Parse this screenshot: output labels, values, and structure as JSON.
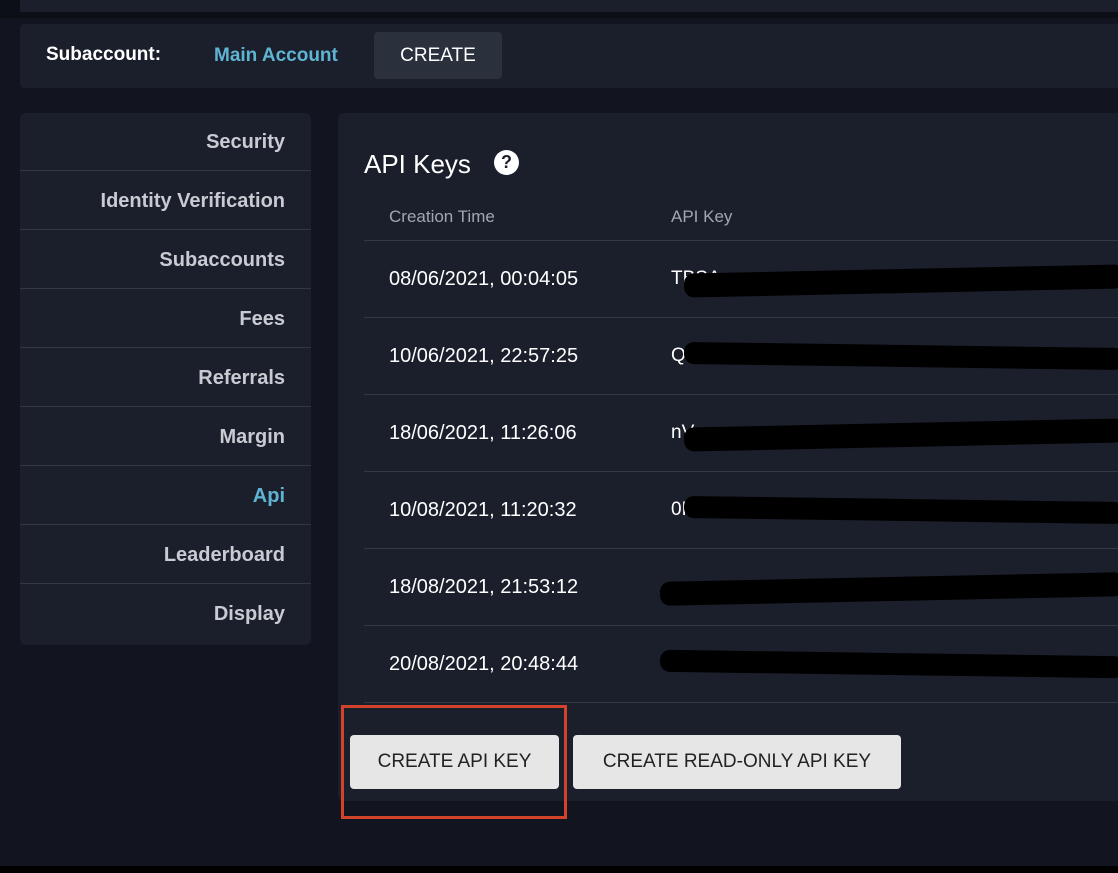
{
  "header": {
    "subaccount_label": "Subaccount:",
    "current_account": "Main Account",
    "create_label": "CREATE"
  },
  "sidebar": {
    "items": [
      {
        "label": "Security"
      },
      {
        "label": "Identity Verification"
      },
      {
        "label": "Subaccounts"
      },
      {
        "label": "Fees"
      },
      {
        "label": "Referrals"
      },
      {
        "label": "Margin"
      },
      {
        "label": "Api"
      },
      {
        "label": "Leaderboard"
      },
      {
        "label": "Display"
      }
    ],
    "active_item": "Api"
  },
  "main": {
    "title": "API Keys",
    "help_icon": "?",
    "columns": [
      "Creation Time",
      "API Key"
    ],
    "rows": [
      {
        "time": "08/06/2021, 00:04:05",
        "key_prefix": "TBSA"
      },
      {
        "time": "10/06/2021, 22:57:25",
        "key_prefix": "QYk"
      },
      {
        "time": "18/06/2021, 11:26:06",
        "key_prefix": "nV"
      },
      {
        "time": "10/08/2021, 11:20:32",
        "key_prefix": "0R"
      },
      {
        "time": "18/08/2021, 21:53:12",
        "key_prefix": ""
      },
      {
        "time": "20/08/2021, 20:48:44",
        "key_prefix": ""
      }
    ],
    "create_key_label": "CREATE API KEY",
    "create_readonly_label": "CREATE READ-ONLY API KEY"
  },
  "colors": {
    "background": "#12151f",
    "panel": "#1b1f2b",
    "accent": "#5fb4d4",
    "highlight": "#d2432c"
  }
}
